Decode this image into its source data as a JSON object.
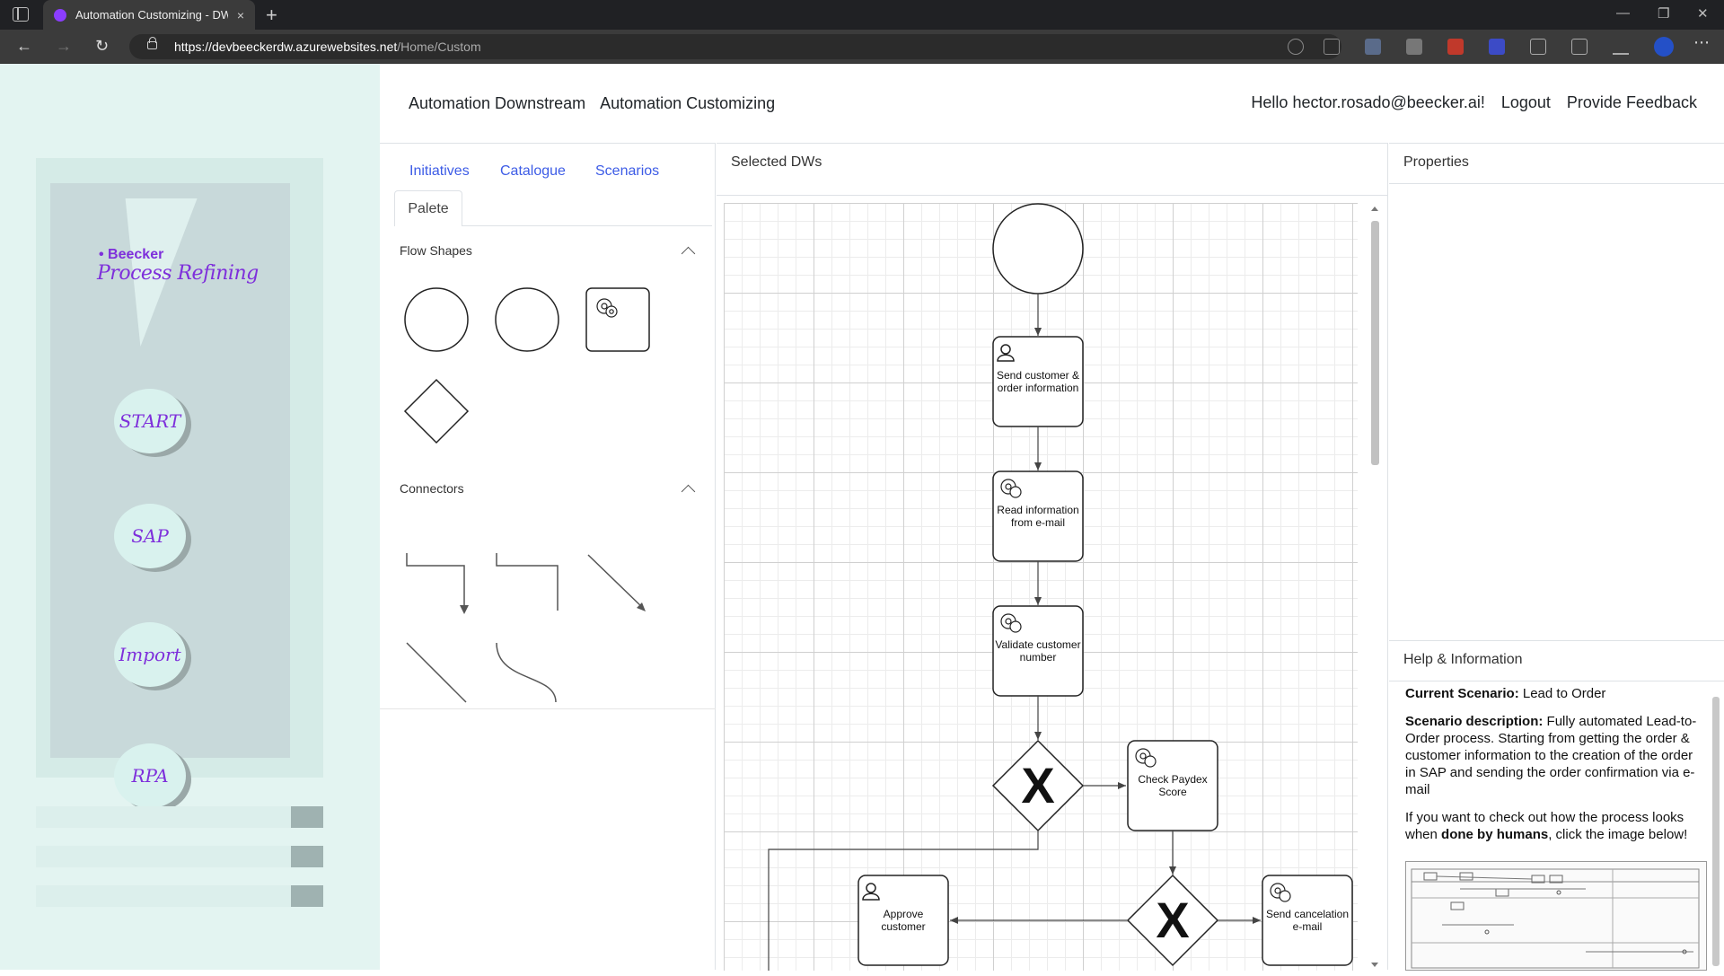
{
  "browser": {
    "tab_title": "Automation Customizing - DW",
    "url_host": "https://devbeeckerdw.azurewebsites.net",
    "url_path": "/Home/Custom",
    "new_tab": "+",
    "close": "×"
  },
  "brand": {
    "small": "• Beecker",
    "big": "Process Refining"
  },
  "left_buttons": [
    "START",
    "SAP",
    "Import",
    "RPA"
  ],
  "header": {
    "nav": [
      "Automation Downstream",
      "Automation Customizing"
    ],
    "greeting": "Hello hector.rosado@beecker.ai!",
    "logout": "Logout",
    "feedback": "Provide Feedback"
  },
  "tools": {
    "tabs": [
      "Initiatives",
      "Catalogue",
      "Scenarios"
    ],
    "active_tab": "Palete",
    "flow_shapes_title": "Flow Shapes",
    "connectors_title": "Connectors"
  },
  "canvas": {
    "title": "Selected DWs",
    "nodes": [
      {
        "label1": "Send customer &",
        "label2": "order information",
        "icon": "user-icon"
      },
      {
        "label1": "Read information",
        "label2": "from e-mail",
        "icon": "gear-icon"
      },
      {
        "label1": "Validate customer",
        "label2": "number",
        "icon": "gear-icon"
      },
      {
        "label1": "Check Paydex",
        "label2": "Score",
        "icon": "gear-icon"
      },
      {
        "label1": "Approve",
        "label2": "customer",
        "icon": "user-icon"
      },
      {
        "label1": "Send cancelation",
        "label2": "e-mail",
        "icon": "gear-icon"
      }
    ],
    "gateway_symbol": "X"
  },
  "properties": {
    "title": "Properties"
  },
  "help": {
    "title": "Help & Information",
    "scenario_label": "Current Scenario:",
    "scenario_value": "Lead to Order",
    "desc_label": "Scenario description:",
    "desc_value": "Fully automated Lead-to-Order process. Starting from getting the order & customer information to the creation of the order in SAP and sending the order confirmation via e-mail",
    "check_pre": "If you want to check out how the process looks when ",
    "check_bold": "done by humans",
    "check_post": ", click the image below!"
  },
  "colors": {
    "accent": "#7e2fdb",
    "link": "#3d5ce6",
    "left_bg": "#e3f4f1"
  }
}
